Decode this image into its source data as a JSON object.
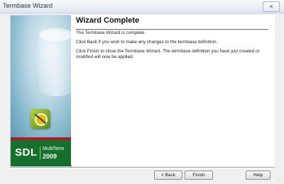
{
  "window": {
    "title": "Termbase Wizard",
    "close_icon": "×"
  },
  "sidebar": {
    "brand_name": "SDL",
    "brand_product": "MultiTerm",
    "brand_year": "2009",
    "logo_icon": "termbase-logo-icon",
    "stripe_color": "#b11a22",
    "brand_color": "#16702d"
  },
  "content": {
    "heading": "Wizard Complete",
    "paragraphs": [
      "The Termbase Wizard is complete.",
      "Click Back if you wish to make any changes to the termbase definition.",
      "Click Finish to close the Termbase Wizard. The termbase definition you have just created or modified will now be applied."
    ]
  },
  "buttons": {
    "back": "< Back",
    "finish": "Finish",
    "help": "Help"
  }
}
